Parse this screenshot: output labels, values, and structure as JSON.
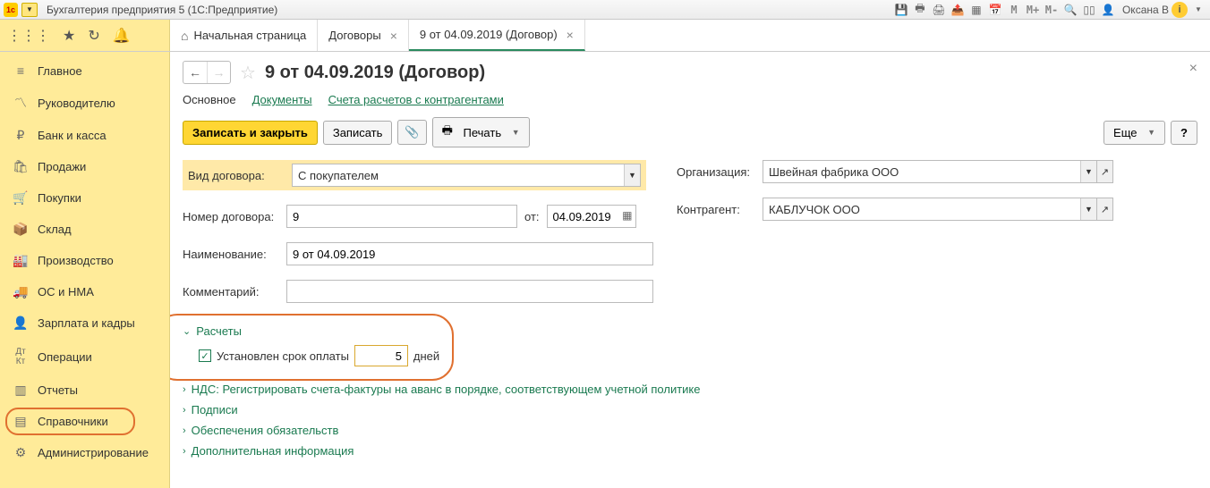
{
  "titlebar": {
    "app_logo_text": "1c",
    "title": "Бухгалтерия предприятия 5   (1С:Предприятие)",
    "toolbar_icons": [
      "save-icon",
      "print-icon",
      "printer2-icon",
      "export-icon",
      "grid-icon",
      "calendar-icon"
    ],
    "m_buttons": [
      "M",
      "M+",
      "M-"
    ],
    "user_name": "Оксана В",
    "info": "i"
  },
  "tabs": {
    "home": "Начальная страница",
    "items": [
      {
        "label": "Договоры",
        "closable": true,
        "active": false
      },
      {
        "label": "9 от 04.09.2019 (Договор)",
        "closable": true,
        "active": true
      }
    ]
  },
  "sidebar": [
    {
      "icon": "home",
      "label": "Главное"
    },
    {
      "icon": "chart",
      "label": "Руководителю"
    },
    {
      "icon": "ruble",
      "label": "Банк и касса"
    },
    {
      "icon": "bag",
      "label": "Продажи"
    },
    {
      "icon": "cart",
      "label": "Покупки"
    },
    {
      "icon": "box",
      "label": "Склад"
    },
    {
      "icon": "factory",
      "label": "Производство"
    },
    {
      "icon": "truck",
      "label": "ОС и НМА"
    },
    {
      "icon": "person",
      "label": "Зарплата и кадры"
    },
    {
      "icon": "dtkt",
      "label": "Операции"
    },
    {
      "icon": "bars",
      "label": "Отчеты"
    },
    {
      "icon": "book",
      "label": "Справочники",
      "highlight": true
    },
    {
      "icon": "gear",
      "label": "Администрирование"
    }
  ],
  "page": {
    "title": "9 от 04.09.2019 (Договор)",
    "subtabs": {
      "main": "Основное",
      "docs": "Документы",
      "accounts": "Счета расчетов с контрагентами"
    },
    "buttons": {
      "save_close": "Записать и закрыть",
      "save": "Записать",
      "print": "Печать",
      "more": "Еще",
      "help": "?"
    },
    "form": {
      "contract_type_label": "Вид договора:",
      "contract_type_value": "С покупателем",
      "org_label": "Организация:",
      "org_value": "Швейная фабрика ООО",
      "number_label": "Номер договора:",
      "number_value": "9",
      "from_label": "от:",
      "date_value": "04.09.2019",
      "counterparty_label": "Контрагент:",
      "counterparty_value": "КАБЛУЧОК ООО",
      "name_label": "Наименование:",
      "name_value": "9 от 04.09.2019",
      "comment_label": "Комментарий:",
      "comment_value": ""
    },
    "sections": {
      "calc": "Расчеты",
      "payment_term_label": "Установлен срок оплаты",
      "payment_term_days": "5",
      "payment_term_unit": "дней",
      "vat": "НДС: Регистрировать счета-фактуры на аванс в порядке, соответствующем учетной политике",
      "sign": "Подписи",
      "secure": "Обеспечения обязательств",
      "extra": "Дополнительная информация"
    }
  }
}
